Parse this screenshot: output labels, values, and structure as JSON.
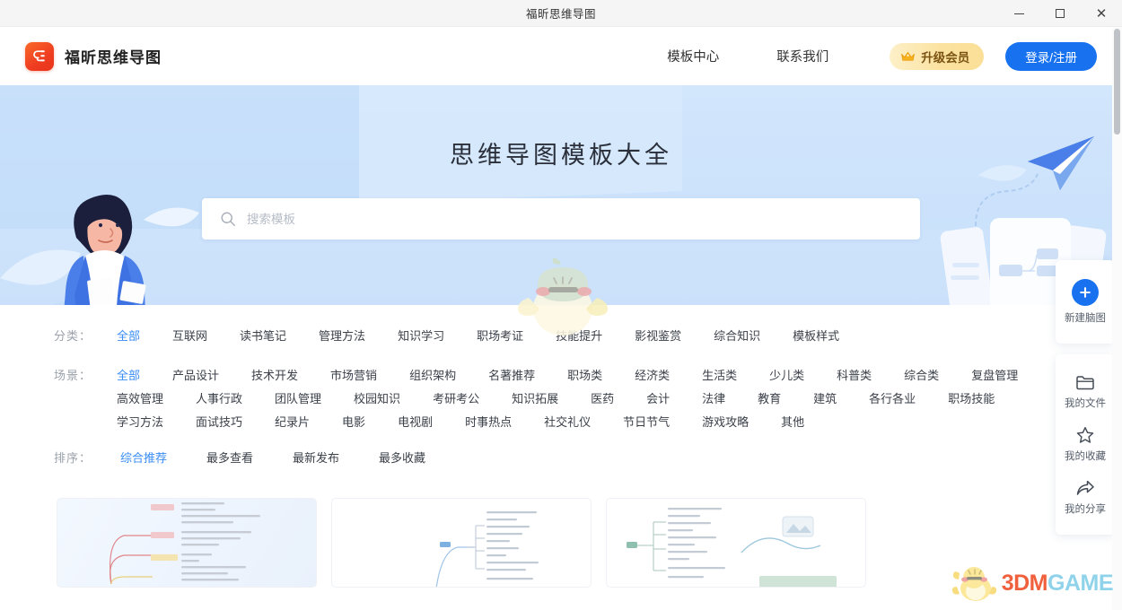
{
  "window": {
    "title": "福昕思维导图",
    "controls": [
      {
        "name": "minimize",
        "glyph": "—"
      },
      {
        "name": "maximize",
        "glyph": "□"
      },
      {
        "name": "close",
        "glyph": "✕"
      }
    ]
  },
  "navbar": {
    "brand": "福昕思维导图",
    "logo_icon": "foxit-mindmap-logo-icon",
    "links": [
      "模板中心",
      "联系我们"
    ],
    "vip_button": "升级会员",
    "vip_icon": "crown-icon",
    "login_button": "登录/注册"
  },
  "hero": {
    "title": "思维导图模板大全",
    "search": {
      "placeholder": "搜索模板",
      "value": "",
      "icon": "search-icon"
    }
  },
  "filters": [
    {
      "key": "category",
      "label": "分类：",
      "items": [
        "全部",
        "互联网",
        "读书笔记",
        "管理方法",
        "知识学习",
        "职场考证",
        "技能提升",
        "影视鉴赏",
        "综合知识",
        "模板样式"
      ],
      "active": "全部"
    },
    {
      "key": "scene",
      "label": "场景：",
      "items": [
        "全部",
        "产品设计",
        "技术开发",
        "市场营销",
        "组织架构",
        "名著推荐",
        "职场类",
        "经济类",
        "生活类",
        "少儿类",
        "科普类",
        "综合类",
        "复盘管理",
        "高效管理",
        "人事行政",
        "团队管理",
        "校园知识",
        "考研考公",
        "知识拓展",
        "医药",
        "会计",
        "法律",
        "教育",
        "建筑",
        "各行各业",
        "职场技能",
        "学习方法",
        "面试技巧",
        "纪录片",
        "电影",
        "电视剧",
        "时事热点",
        "社交礼仪",
        "节日节气",
        "游戏攻略",
        "其他"
      ],
      "active": "全部"
    },
    {
      "key": "sort",
      "label": "排序：",
      "items": [
        "综合推荐",
        "最多查看",
        "最新发布",
        "最多收藏"
      ],
      "active": "综合推荐"
    }
  ],
  "cards": [
    {
      "name": "template-card-1",
      "thumb": "mindmap-thumbnail-red-yellow"
    },
    {
      "name": "template-card-2",
      "thumb": "mindmap-thumbnail-blue"
    },
    {
      "name": "template-card-3",
      "thumb": "mindmap-thumbnail-green"
    }
  ],
  "dock": {
    "primary": {
      "label": "新建脑图",
      "icon": "plus-icon"
    },
    "items": [
      {
        "label": "我的文件",
        "icon": "folder-icon"
      },
      {
        "label": "我的收藏",
        "icon": "star-icon"
      },
      {
        "label": "我的分享",
        "icon": "share-arrow-icon"
      }
    ]
  },
  "watermark": {
    "mascot_icon": "chick-mascot-icon",
    "text_part1": "3DM",
    "text_part2": "GAME"
  },
  "colors": {
    "accent_blue": "#1872f0",
    "link_blue": "#3a8cf5",
    "hero_blue": "#cfe4fb",
    "vip_gold": "#fbe2a0",
    "logo_orange": "#ef3d21"
  }
}
